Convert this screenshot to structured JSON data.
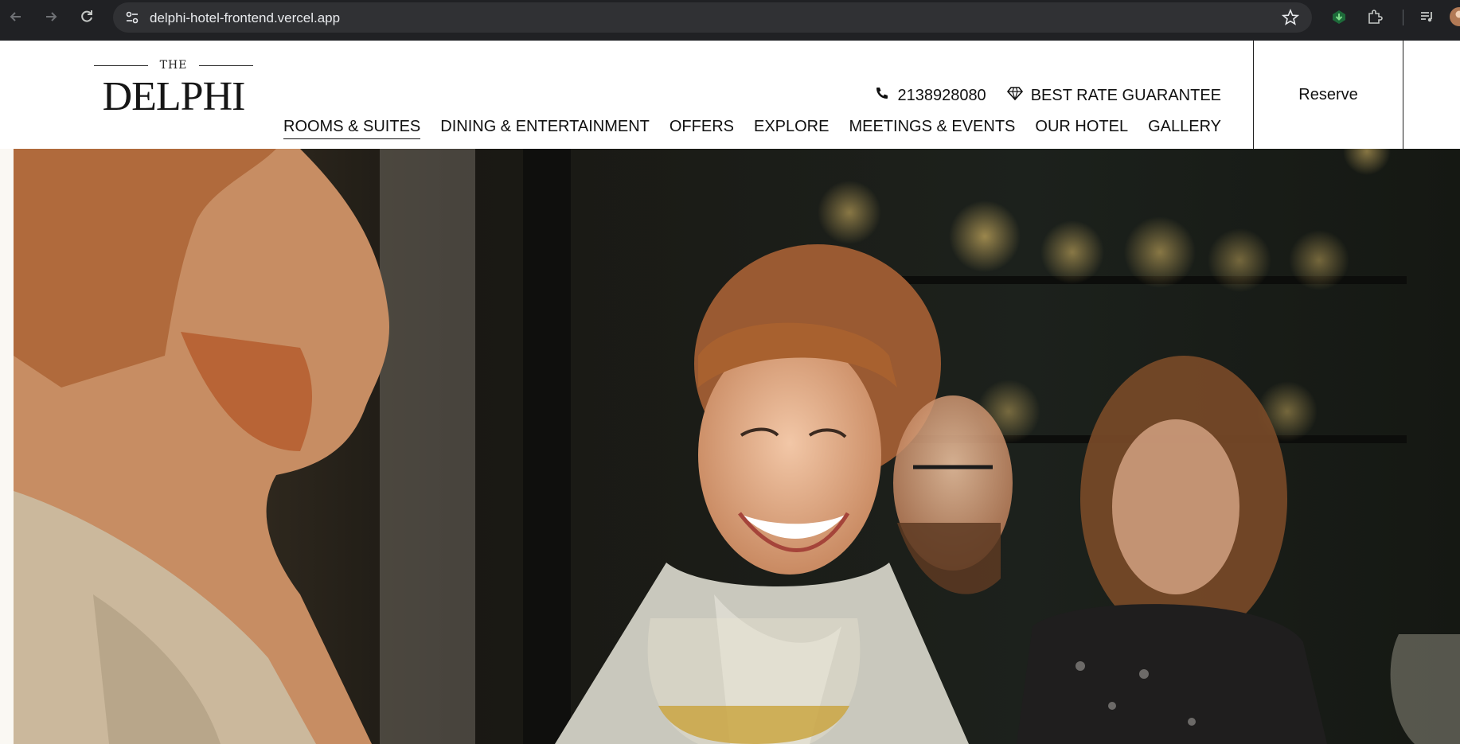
{
  "browser": {
    "url": "delphi-hotel-frontend.vercel.app",
    "icons": [
      "back-arrow-icon",
      "forward-arrow-icon",
      "reload-icon",
      "site-settings-icon",
      "bookmark-star-icon",
      "download-extension-icon",
      "extensions-puzzle-icon",
      "media-queue-icon",
      "profile-avatar-icon"
    ]
  },
  "site": {
    "logo": {
      "the": "THE",
      "name": "DELPHI"
    },
    "contact": {
      "phone": "2138928080",
      "guarantee": "BEST RATE GUARANTEE"
    },
    "nav": [
      {
        "label": "ROOMS & SUITES",
        "active": true
      },
      {
        "label": "DINING & ENTERTAINMENT"
      },
      {
        "label": "OFFERS"
      },
      {
        "label": "EXPLORE"
      },
      {
        "label": "MEETINGS & EVENTS"
      },
      {
        "label": "OUR HOTEL"
      },
      {
        "label": "GALLERY"
      }
    ],
    "reserve_label": "Reserve"
  },
  "hero": {
    "image": "photo-friends-smiling-with-wine-glasses-at-bar"
  }
}
